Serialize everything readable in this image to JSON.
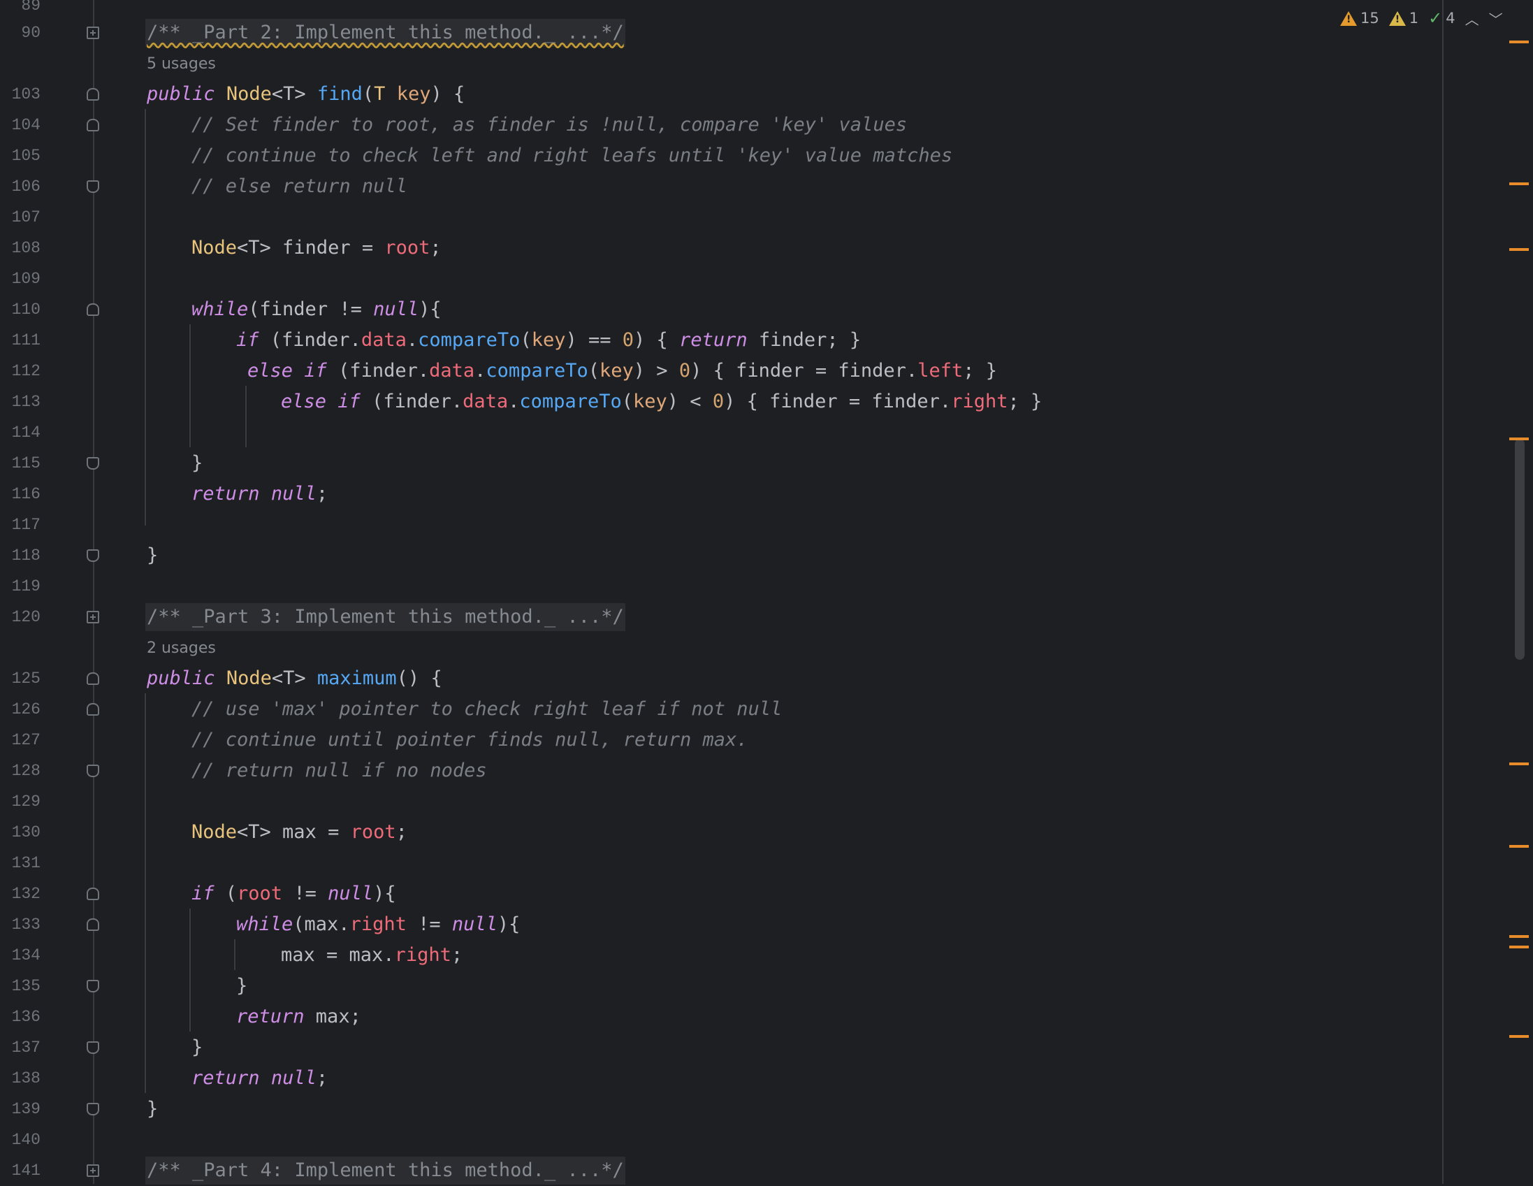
{
  "inspections": {
    "warnings_count": "15",
    "weak_warnings_count": "1",
    "typos_count": "4"
  },
  "doc_comments": {
    "part2": "/** _Part 2: Implement this method._ ...*/",
    "part3": "/** _Part 3: Implement this method._ ...*/",
    "part4": "/** _Part 4: Implement this method._ ...*/"
  },
  "usages": {
    "find": "5 usages",
    "maximum": "2 usages"
  },
  "line_numbers": {
    "n89": "89",
    "n90": "90",
    "n103": "103",
    "n104": "104",
    "n105": "105",
    "n106": "106",
    "n107": "107",
    "n108": "108",
    "n109": "109",
    "n110": "110",
    "n111": "111",
    "n112": "112",
    "n113": "113",
    "n114": "114",
    "n115": "115",
    "n116": "116",
    "n117": "117",
    "n118": "118",
    "n119": "119",
    "n120": "120",
    "n125": "125",
    "n126": "126",
    "n127": "127",
    "n128": "128",
    "n129": "129",
    "n130": "130",
    "n131": "131",
    "n132": "132",
    "n133": "133",
    "n134": "134",
    "n135": "135",
    "n136": "136",
    "n137": "137",
    "n138": "138",
    "n139": "139",
    "n140": "140",
    "n141": "141"
  },
  "code": {
    "l103": {
      "a": "public",
      "b": "Node",
      "c": "<T> ",
      "d": "find",
      "e": "(",
      "f": "T",
      "g": " ",
      "h": "key",
      "i": ") {"
    },
    "l104": "// Set finder to root, as finder is !null, compare 'key' values",
    "l105": "// continue to check left and right leafs until 'key' value matches",
    "l106": "// else return null",
    "l108": {
      "a": "Node",
      "b": "<T> finder = ",
      "c": "root",
      "d": ";"
    },
    "l110": {
      "a": "while",
      "b": "(finder != ",
      "c": "null",
      "d": "){"
    },
    "l111": {
      "a": "if",
      "b": " (finder.",
      "c": "data",
      "d": ".",
      "e": "compareTo",
      "f": "(",
      "g": "key",
      "h": ") == ",
      "i": "0",
      "j": ") { ",
      "k": "return",
      "l": " finder; }"
    },
    "l112": {
      "a": "else",
      "b": " ",
      "c": "if",
      "d": " (finder.",
      "e": "data",
      "f": ".",
      "g": "compareTo",
      "h": "(",
      "i": "key",
      "j": ") > ",
      "k": "0",
      "l": ") { finder = finder.",
      "m": "left",
      "n": "; }"
    },
    "l113": {
      "a": "else",
      "b": " ",
      "c": "if",
      "d": " (finder.",
      "e": "data",
      "f": ".",
      "g": "compareTo",
      "h": "(",
      "i": "key",
      "j": ") < ",
      "k": "0",
      "l": ") { finder = finder.",
      "m": "right",
      "n": "; }"
    },
    "l115": "}",
    "l116": {
      "a": "return",
      "b": " ",
      "c": "null",
      "d": ";"
    },
    "l118": "}",
    "l125": {
      "a": "public",
      "b": "Node",
      "c": "<T> ",
      "d": "maximum",
      "e": "() {"
    },
    "l126": "// use 'max' pointer to check right leaf if not null",
    "l127": "// continue until pointer finds null, return max.",
    "l128": "// return null if no nodes",
    "l130": {
      "a": "Node",
      "b": "<T> max = ",
      "c": "root",
      "d": ";"
    },
    "l132": {
      "a": "if",
      "b": " (",
      "c": "root",
      "d": " != ",
      "e": "null",
      "f": "){"
    },
    "l133": {
      "a": "while",
      "b": "(max.",
      "c": "right",
      "d": " != ",
      "e": "null",
      "f": "){"
    },
    "l134": {
      "a": "max = max.",
      "b": "right",
      "c": ";"
    },
    "l135": "}",
    "l136": {
      "a": "return",
      "b": " max;"
    },
    "l137": "}",
    "l138": {
      "a": "return",
      "b": " ",
      "c": "null",
      "d": ";"
    },
    "l139": "}"
  },
  "colors": {
    "background": "#1e1f22",
    "keyword": "#cf8ee6",
    "type": "#e8c37e",
    "function": "#56a8f5",
    "field": "#ee6b7a",
    "comment": "#7a7e85",
    "warning_marker": "#e88b2a"
  }
}
